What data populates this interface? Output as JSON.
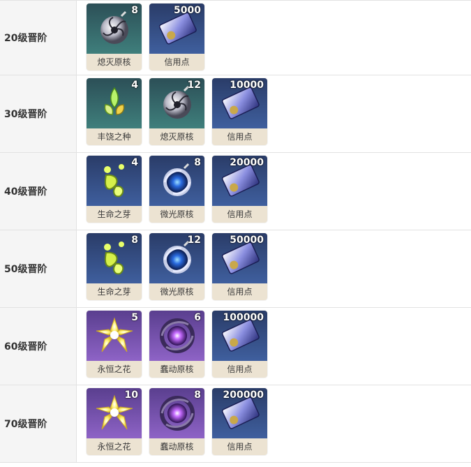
{
  "rows": [
    {
      "level": "20级晋阶",
      "items": [
        {
          "name": "熄灭原核",
          "count": "8",
          "bg": "teal",
          "icon": "extinguish-core-icon"
        },
        {
          "name": "信用点",
          "count": "5000",
          "bg": "blue",
          "icon": "credit-card-icon"
        }
      ]
    },
    {
      "level": "30级晋阶",
      "items": [
        {
          "name": "丰饶之种",
          "count": "4",
          "bg": "teal",
          "icon": "abundance-seed-icon"
        },
        {
          "name": "熄灭原核",
          "count": "12",
          "bg": "teal",
          "icon": "extinguish-core-icon"
        },
        {
          "name": "信用点",
          "count": "10000",
          "bg": "blue",
          "icon": "credit-card-icon"
        }
      ]
    },
    {
      "level": "40级晋阶",
      "items": [
        {
          "name": "生命之芽",
          "count": "4",
          "bg": "blue",
          "icon": "life-sprout-icon"
        },
        {
          "name": "微光原核",
          "count": "8",
          "bg": "blue",
          "icon": "glimmer-core-icon"
        },
        {
          "name": "信用点",
          "count": "20000",
          "bg": "blue",
          "icon": "credit-card-icon"
        }
      ]
    },
    {
      "level": "50级晋阶",
      "items": [
        {
          "name": "生命之芽",
          "count": "8",
          "bg": "blue",
          "icon": "life-sprout-icon"
        },
        {
          "name": "微光原核",
          "count": "12",
          "bg": "blue",
          "icon": "glimmer-core-icon"
        },
        {
          "name": "信用点",
          "count": "50000",
          "bg": "blue",
          "icon": "credit-card-icon"
        }
      ]
    },
    {
      "level": "60级晋阶",
      "items": [
        {
          "name": "永恒之花",
          "count": "5",
          "bg": "purple",
          "icon": "eternal-flower-icon"
        },
        {
          "name": "蠢动原核",
          "count": "6",
          "bg": "purple",
          "icon": "squirming-core-icon"
        },
        {
          "name": "信用点",
          "count": "100000",
          "bg": "blue",
          "icon": "credit-card-icon"
        }
      ]
    },
    {
      "level": "70级晋阶",
      "items": [
        {
          "name": "永恒之花",
          "count": "10",
          "bg": "purple",
          "icon": "eternal-flower-icon"
        },
        {
          "name": "蠢动原核",
          "count": "8",
          "bg": "purple",
          "icon": "squirming-core-icon"
        },
        {
          "name": "信用点",
          "count": "200000",
          "bg": "blue",
          "icon": "credit-card-icon"
        }
      ]
    }
  ]
}
